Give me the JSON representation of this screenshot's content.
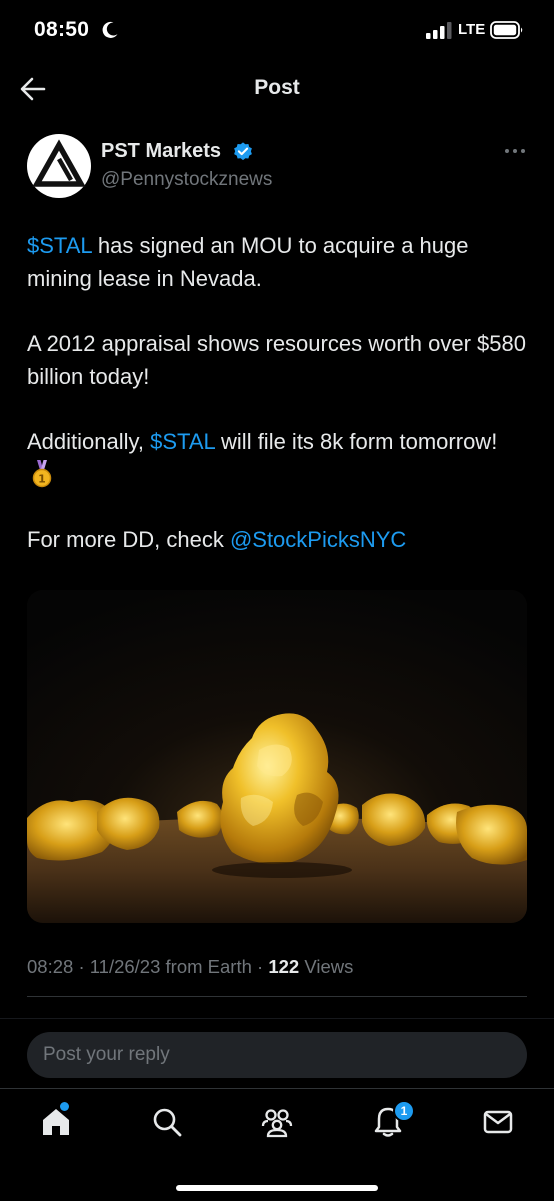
{
  "status_bar": {
    "time": "08:50",
    "network": "LTE"
  },
  "header": {
    "title": "Post"
  },
  "post": {
    "author": {
      "display_name": "PST Markets",
      "handle": "@Pennystockznews",
      "verified": true
    },
    "paragraphs": [
      {
        "ticker": "$STAL",
        "text": " has signed an MOU to acquire a huge mining lease in Nevada."
      },
      {
        "text": "A 2012 appraisal shows resources worth over $580 billion today!"
      },
      {
        "prefix": "Additionally, ",
        "ticker": "$STAL",
        "text": " will file its 8k form tomorrow! ",
        "emoji": "medal-icon"
      },
      {
        "prefix": "For more DD, check ",
        "mention": "@StockPicksNYC"
      }
    ],
    "media_description": "gold-nuggets-image",
    "meta": {
      "time": "08:28",
      "date": "11/26/23",
      "source": "from Earth",
      "views_count": "122",
      "views_label": "Views"
    }
  },
  "reply": {
    "placeholder": "Post your reply"
  },
  "tab_bar": {
    "items": [
      {
        "icon": "home-icon"
      },
      {
        "icon": "search-icon"
      },
      {
        "icon": "communities-icon"
      },
      {
        "icon": "notifications-icon",
        "badge": "1"
      },
      {
        "icon": "messages-icon"
      }
    ]
  },
  "colors": {
    "link": "#1d9bf0",
    "background": "#000000",
    "secondary_text": "#71767b",
    "primary_text": "#e7e9ea"
  }
}
